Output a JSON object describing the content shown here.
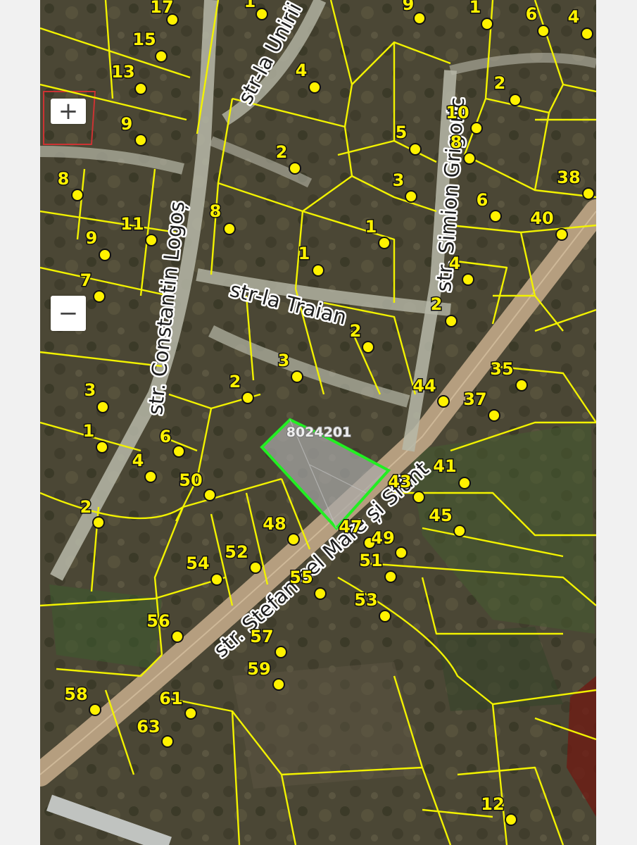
{
  "zoom": {
    "in_label": "+",
    "out_label": "−"
  },
  "parcel": {
    "id": "8024201",
    "highlight_color": "#22ee22"
  },
  "colors": {
    "parcel_lines": "#f2f200",
    "road": "#b8a184",
    "marker": "#fff200"
  },
  "streets": [
    "str-la Unirii",
    "str. Constantin Logoș",
    "str-la Traian",
    "str. Simion Grigoric",
    "str. Ștefan cel Mare și Sfânt"
  ],
  "house_numbers": [
    "17",
    "1",
    "9",
    "1",
    "6",
    "4",
    "15",
    "4",
    "13",
    "2",
    "10",
    "9",
    "5",
    "8",
    "2",
    "8",
    "3",
    "38",
    "6",
    "11",
    "8",
    "1",
    "40",
    "9",
    "1",
    "4",
    "7",
    "2",
    "2",
    "35",
    "3",
    "3",
    "2",
    "44",
    "37",
    "1",
    "6",
    "41",
    "4",
    "50",
    "43",
    "2",
    "45",
    "48",
    "47",
    "49",
    "52",
    "51",
    "54",
    "55",
    "53",
    "56",
    "57",
    "59",
    "58",
    "61",
    "63",
    "12"
  ]
}
